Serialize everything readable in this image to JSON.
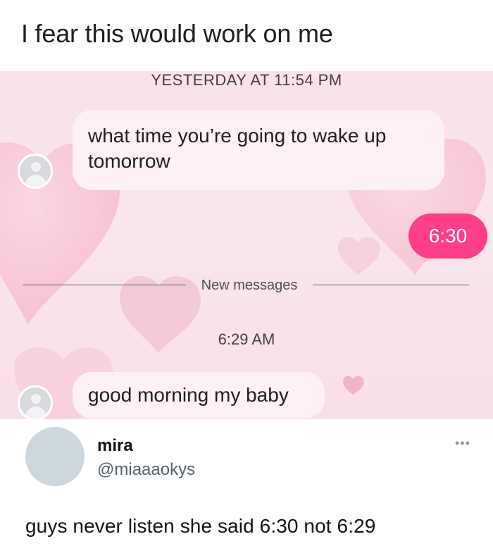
{
  "post": {
    "title": "I fear this would work on me"
  },
  "chat": {
    "timestamp_top": "YESTERDAY AT 11:54 PM",
    "incoming_1": "what time you’re going to wake up tomorrow",
    "outgoing_1": "6:30",
    "divider_label": "New messages",
    "timestamp_mid": "6:29 AM",
    "incoming_2": "good morning my baby",
    "colors": {
      "background": "#fae1ea",
      "incoming_bubble": "#fdf1f3",
      "outgoing_bubble": "#ff3e89",
      "hearts": "#f7bfd1"
    },
    "icons": [
      "default-avatar-icon",
      "heart-icon"
    ]
  },
  "tweet": {
    "name": "mira",
    "handle": "@miaaaokys",
    "text": "guys never listen she said 6:30 not 6:29",
    "more_icon": "more-options-icon",
    "more_glyph": "•••"
  }
}
